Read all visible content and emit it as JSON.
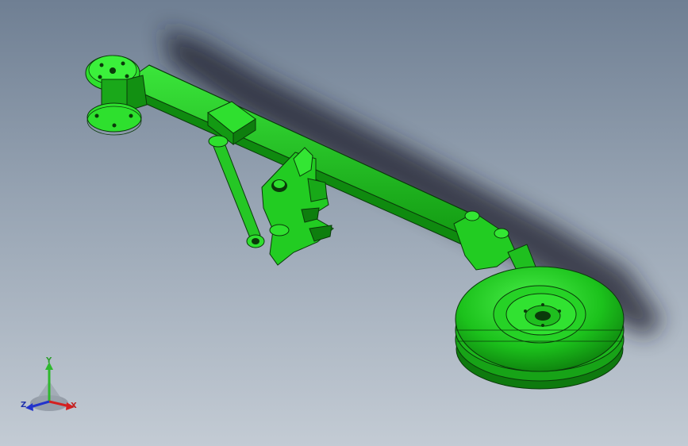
{
  "viewport": {
    "background_top": "#6f7f93",
    "background_bottom": "#c3cbd4"
  },
  "model": {
    "body_color": "#1fc41f",
    "edge_color": "#0a3a0a",
    "shadow_color": "#1a1f2a"
  },
  "triad": {
    "x_label": "X",
    "y_label": "Y",
    "z_label": "Z",
    "x_color": "#d42020",
    "y_color": "#2eb82e",
    "z_color": "#2233cc"
  }
}
